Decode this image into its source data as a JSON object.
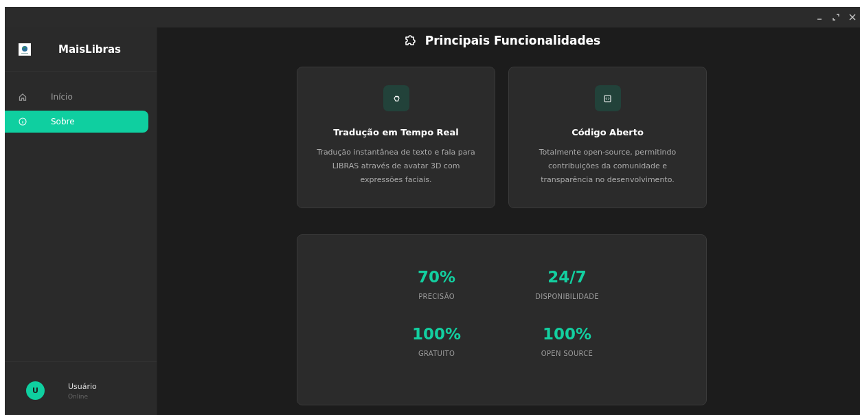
{
  "app": {
    "name": "MaisLibras"
  },
  "nav": [
    {
      "label": "Início",
      "selected": false
    },
    {
      "label": "Sobre",
      "selected": true
    }
  ],
  "user": {
    "initial": "U",
    "name": "Usuário",
    "status": "Online"
  },
  "section": {
    "title": "Principais Funcionalidades"
  },
  "features": [
    {
      "title": "Tradução em Tempo Real",
      "description": "Tradução instantânea de texto e fala para LIBRAS através de avatar 3D com expressões faciais."
    },
    {
      "title": "Código Aberto",
      "description": "Totalmente open-source, permitindo contribuições da comunidade e transparência no desenvolvimento."
    }
  ],
  "stats": [
    {
      "value": "70%",
      "label": "PRECISÃO"
    },
    {
      "value": "24/7",
      "label": "DISPONIBILIDADE"
    },
    {
      "value": "100%",
      "label": "GRATUITO"
    },
    {
      "value": "100%",
      "label": "OPEN SOURCE"
    }
  ]
}
